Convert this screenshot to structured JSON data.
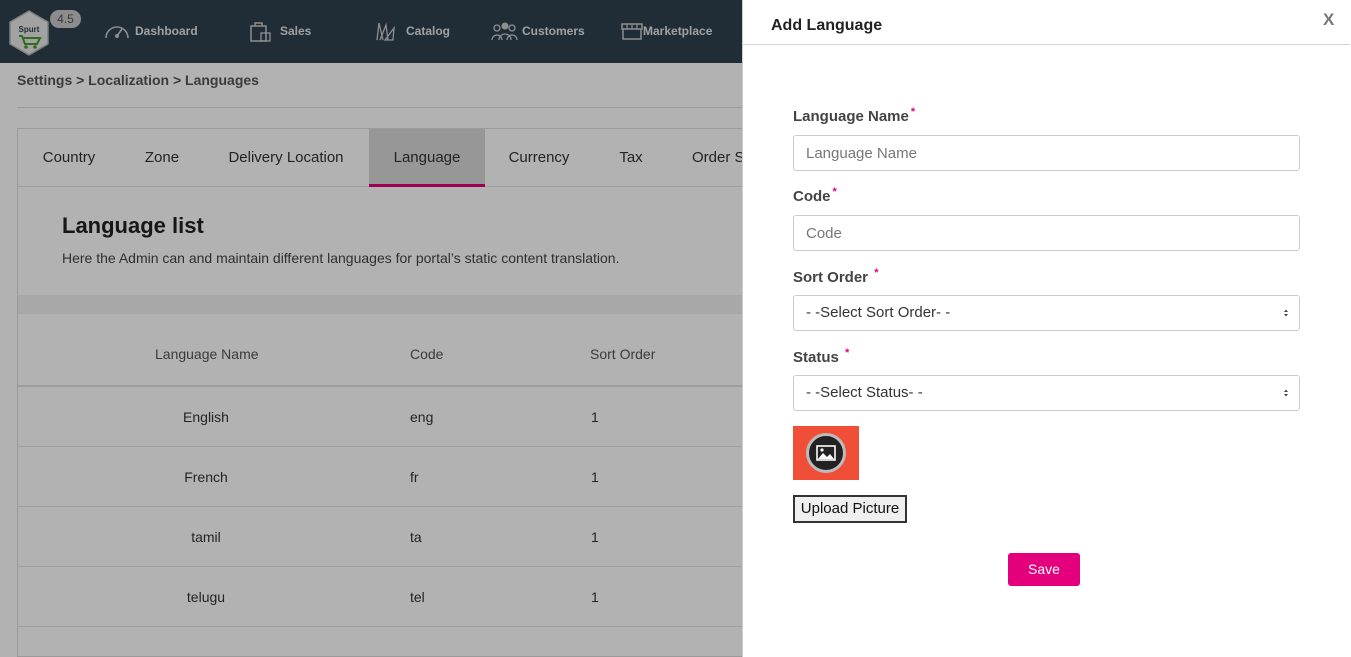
{
  "header": {
    "version": "4.5",
    "logo_text": "Spurt",
    "nav": [
      {
        "label": "Dashboard",
        "icon": "speedometer-icon"
      },
      {
        "label": "Sales",
        "icon": "shopping-bag-icon"
      },
      {
        "label": "Catalog",
        "icon": "catalog-icon"
      },
      {
        "label": "Customers",
        "icon": "users-icon"
      },
      {
        "label": "Marketplace",
        "icon": "store-icon"
      }
    ]
  },
  "breadcrumb": "Settings > Localization > Languages",
  "tabs": [
    {
      "label": "Country"
    },
    {
      "label": "Zone"
    },
    {
      "label": "Delivery Location"
    },
    {
      "label": "Language",
      "active": true
    },
    {
      "label": "Currency"
    },
    {
      "label": "Tax"
    },
    {
      "label": "Order S"
    }
  ],
  "language_list": {
    "title": "Language list",
    "description": "Here the Admin can and maintain different languages for portal’s static content translation.",
    "columns": [
      "Language Name",
      "Code",
      "Sort Order"
    ],
    "rows": [
      {
        "name": "English",
        "code": "eng",
        "sort": "1"
      },
      {
        "name": "French",
        "code": "fr",
        "sort": "1"
      },
      {
        "name": "tamil",
        "code": "ta",
        "sort": "1"
      },
      {
        "name": "telugu",
        "code": "tel",
        "sort": "1"
      }
    ]
  },
  "panel": {
    "title": "Add Language",
    "close_label": "X",
    "language_name": {
      "label": "Language Name",
      "placeholder": "Language Name",
      "value": ""
    },
    "code": {
      "label": "Code",
      "placeholder": "Code",
      "value": ""
    },
    "sort_order": {
      "label": "Sort Order",
      "selected": "- -Select Sort Order- -"
    },
    "status": {
      "label": "Status",
      "selected": "- -Select Status- -"
    },
    "upload_label": "Upload Picture",
    "save_label": "Save",
    "required_mark": "*"
  },
  "colors": {
    "accent": "#e4007c",
    "topbar": "#2f4150",
    "preview_bg": "#f04e37"
  }
}
